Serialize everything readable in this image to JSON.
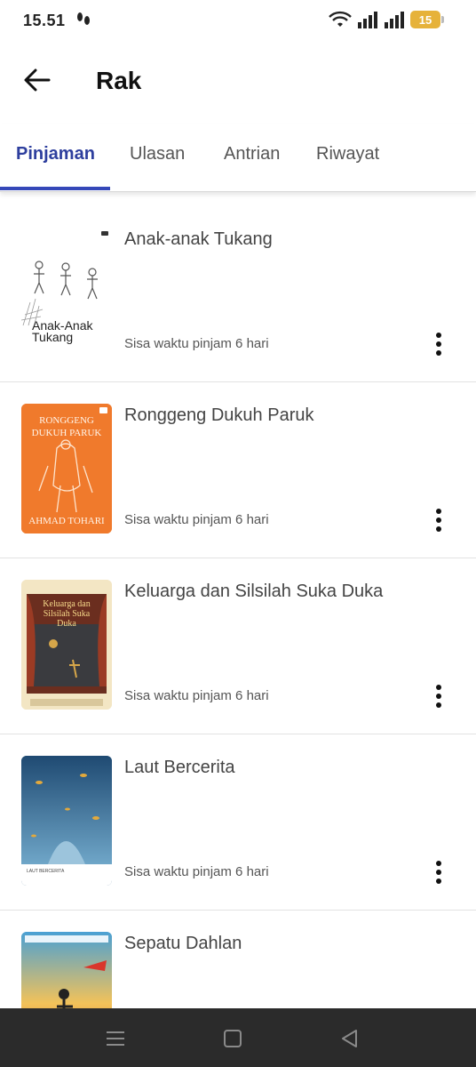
{
  "status_bar": {
    "time": "15.51",
    "battery_level": "15",
    "icons": [
      "footsteps-icon",
      "wifi-icon",
      "signal-icon",
      "signal-icon",
      "battery-icon"
    ]
  },
  "app_bar": {
    "title": "Rak",
    "back_icon": "arrow-left-icon"
  },
  "tabs": [
    {
      "label": "Pinjaman",
      "active": true
    },
    {
      "label": "Ulasan",
      "active": false
    },
    {
      "label": "Antrian",
      "active": false
    },
    {
      "label": "Riwayat",
      "active": false
    }
  ],
  "books": [
    {
      "title": "Anak-anak Tukang",
      "status": "Sisa waktu pinjam 6 hari",
      "cover_text": "Anak-Anak Tukang"
    },
    {
      "title": "Ronggeng Dukuh Paruk",
      "status": "Sisa waktu pinjam 6 hari",
      "cover_text": "RONGGENG DUKUH PARUK",
      "cover_author": "AHMAD TOHARI"
    },
    {
      "title": "Keluarga dan Silsilah Suka Duka",
      "status": "Sisa waktu pinjam 6 hari",
      "cover_text": "Keluarga dan Silsilah Suka Duka"
    },
    {
      "title": "Laut Bercerita",
      "status": "Sisa waktu pinjam 6 hari",
      "cover_text": "LAUT BERCERITA"
    },
    {
      "title": "Sepatu Dahlan",
      "status": "",
      "cover_text": ""
    }
  ],
  "nav_bar": {
    "buttons": [
      "menu-icon",
      "home-square-icon",
      "back-triangle-icon"
    ]
  },
  "colors": {
    "accent": "#3548b8",
    "tab_active_text": "#2e3f9e",
    "nav_bar_bg": "#2b2b2b",
    "battery": "#e6b23a"
  }
}
